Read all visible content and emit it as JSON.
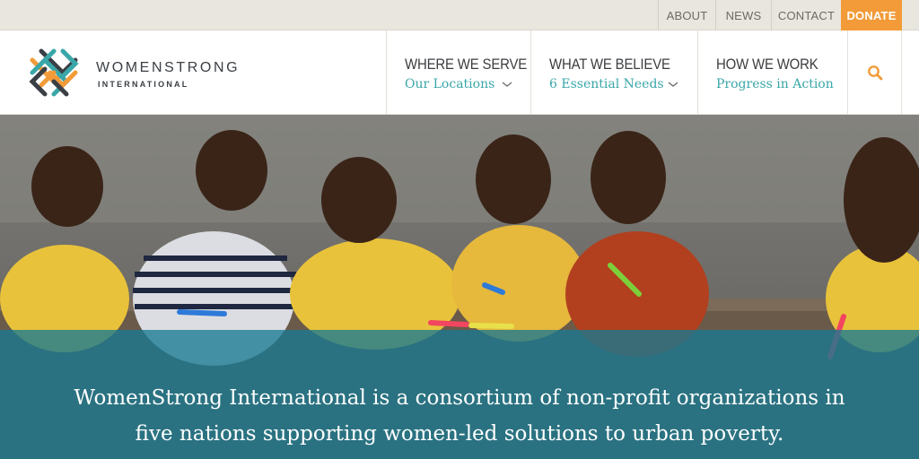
{
  "utility_nav": {
    "about": "ABOUT",
    "news": "NEWS",
    "contact": "CONTACT",
    "donate": "DONATE"
  },
  "brand": {
    "name": "WOMENSTRONG",
    "subtitle": "INTERNATIONAL"
  },
  "main_nav": [
    {
      "title": "WHERE WE SERVE",
      "subtitle": "Our Locations",
      "icon": "chevron-down-icon"
    },
    {
      "title": "WHAT WE BELIEVE",
      "subtitle": "6 Essential Needs",
      "icon": "chevron-down-icon"
    },
    {
      "title": "HOW WE WORK",
      "subtitle": "Progress in Action"
    }
  ],
  "search": {
    "icon": "search-icon"
  },
  "hero": {
    "line1": "WomenStrong International is a consortium of non-profit organizations in",
    "line2": "five nations supporting women-led solutions to urban poverty."
  },
  "colors": {
    "accent_orange": "#f29b38",
    "accent_teal": "#3aa6a8",
    "overlay_blue": "#187891"
  }
}
